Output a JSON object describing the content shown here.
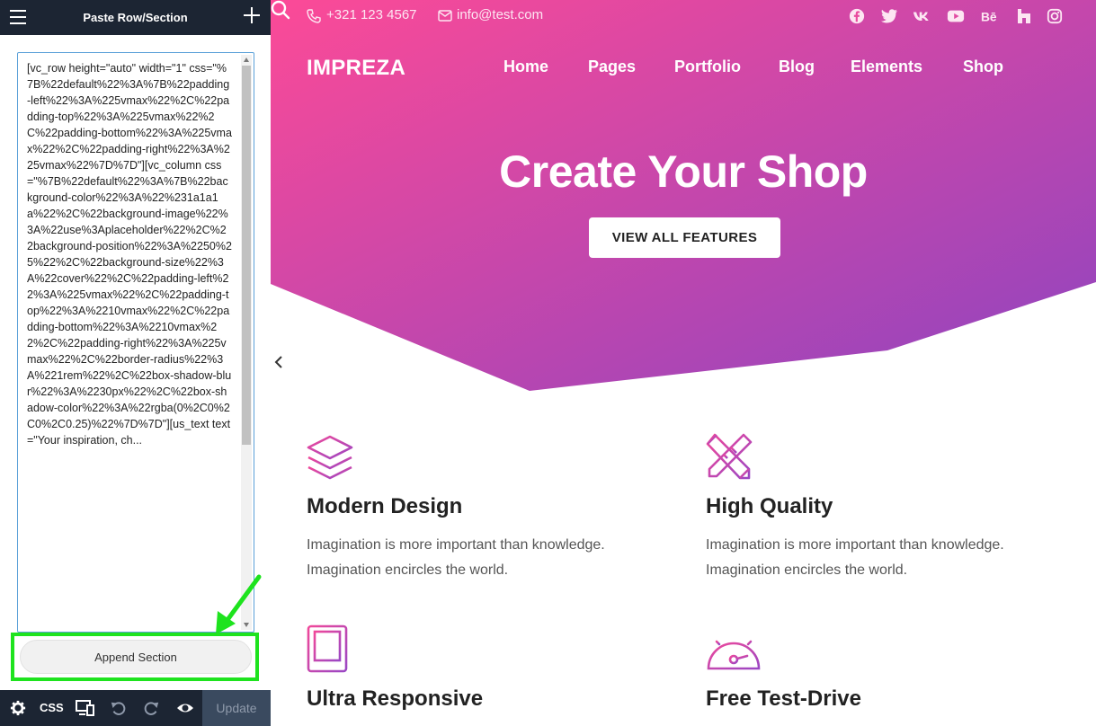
{
  "builder": {
    "header_title": "Paste Row/Section",
    "textarea_value": "[vc_row height=\"auto\" width=\"1\" css=\"%7B%22default%22%3A%7B%22padding-left%22%3A%225vmax%22%2C%22padding-top%22%3A%225vmax%22%2C%22padding-bottom%22%3A%225vmax%22%2C%22padding-right%22%3A%225vmax%22%7D%7D\"][vc_column css=\"%7B%22default%22%3A%7B%22background-color%22%3A%22%231a1a1a%22%2C%22background-image%22%3A%22use%3Aplaceholder%22%2C%22background-position%22%3A%2250%25%22%2C%22background-size%22%3A%22cover%22%2C%22padding-left%22%3A%225vmax%22%2C%22padding-top%22%3A%2210vmax%22%2C%22padding-bottom%22%3A%2210vmax%22%2C%22padding-right%22%3A%225vmax%22%2C%22border-radius%22%3A%221rem%22%2C%22box-shadow-blur%22%3A%2230px%22%2C%22box-shadow-color%22%3A%22rgba(0%2C0%2C0%2C0.25)%22%7D%7D\"][us_text text=\"Your inspiration, ch...",
    "append_button": "Append Section",
    "footer": {
      "css_label": "CSS",
      "update_label": "Update"
    },
    "highlight_color": "#1ee31e"
  },
  "site": {
    "topbar": {
      "phone": "+321 123 4567",
      "email": "info@test.com",
      "social_icons": [
        "facebook-icon",
        "twitter-icon",
        "vk-icon",
        "youtube-icon",
        "behance-icon",
        "houzz-icon",
        "instagram-icon"
      ]
    },
    "brand": "IMPREZA",
    "nav": [
      "Home",
      "Pages",
      "Portfolio",
      "Blog",
      "Elements",
      "Shop"
    ],
    "hero": {
      "title": "Create Your Shop",
      "button": "VIEW ALL FEATURES",
      "gradient_start": "#fc4a97",
      "gradient_end": "#8e44c0"
    },
    "features": [
      {
        "title": "Modern Design",
        "text_line1": "Imagination is more important than knowledge.",
        "text_line2": "Imagination encircles the world.",
        "icon": "layers-icon"
      },
      {
        "title": "High Quality",
        "text_line1": "Imagination is more important than knowledge.",
        "text_line2": "Imagination encircles the world.",
        "icon": "pencil-ruler-icon"
      },
      {
        "title": "Ultra Responsive",
        "icon": "tablet-icon"
      },
      {
        "title": "Free Test-Drive",
        "icon": "speedometer-icon"
      }
    ]
  }
}
